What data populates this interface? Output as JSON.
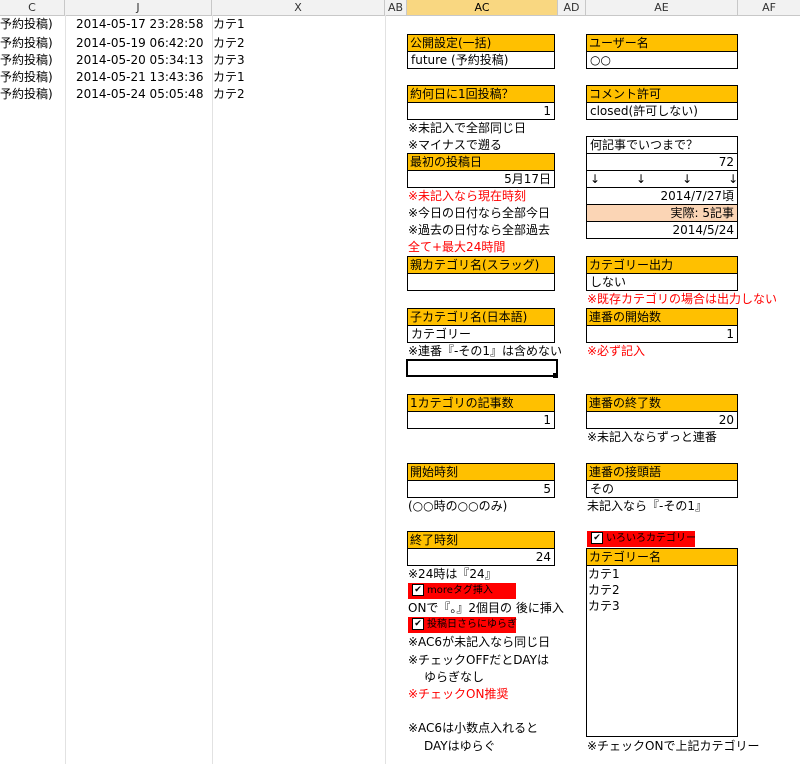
{
  "columns": {
    "c": "C",
    "j": "J",
    "x": "X",
    "ab": "AB",
    "ac": "AC",
    "ad": "AD",
    "ae": "AE",
    "af": "AF"
  },
  "schedule_rows": [
    {
      "type": "予約投稿)",
      "datetime": "2014-05-17 23:28:58",
      "category": "カテ1"
    },
    {
      "type": "予約投稿)",
      "datetime": "2014-05-19 06:42:20",
      "category": "カテ2"
    },
    {
      "type": "予約投稿)",
      "datetime": "2014-05-20 05:34:13",
      "category": "カテ3"
    },
    {
      "type": "予約投稿)",
      "datetime": "2014-05-21 13:43:36",
      "category": "カテ1"
    },
    {
      "type": "予約投稿)",
      "datetime": "2014-05-24 05:05:48",
      "category": "カテ2"
    }
  ],
  "left": {
    "public_label": "公開設定(一括)",
    "public_value": "future (予約投稿)",
    "interval_label": "約何日に1回投稿？",
    "interval_value": "1",
    "note_blank_same": "※未記入で全部同じ日",
    "note_minus": "※マイナスで遡る",
    "first_label": "最初の投稿日",
    "first_value": "5月17日",
    "note_now": "※未記入なら現在時刻",
    "note_today": "※今日の日付なら全部今日",
    "note_past": "※過去の日付なら全部過去",
    "note_max": "全て+最大24時間",
    "parent_label": "親カテゴリ名(スラッグ)",
    "parent_value": "",
    "child_label": "子カテゴリ名(日本語)",
    "child_value": "カテゴリー",
    "note_serial": "※連番『-その1』は含めない",
    "articles_label": "1カテゴリの記事数",
    "articles_value": "1",
    "start_label": "開始時刻",
    "start_value": "5",
    "start_note": "(○○時の○○のみ)",
    "end_label": "終了時刻",
    "end_value": "24",
    "note_24": "※24時は『24』",
    "more_check": "moreタグ挿入",
    "note_on": "ONで『。』2個目の 後に挿入",
    "fuzz_check": "投稿日さらにゆらぎ",
    "note_ac6": "※AC6が未記入なら同じ日",
    "note_off1": "※チェックOFFだとDAYは",
    "note_off2": "ゆらぎなし",
    "note_recommend": "※チェックON推奨",
    "note_decimal1": "※AC6は小数点入れると",
    "note_decimal2": "DAYはゆらぐ"
  },
  "right": {
    "user_label": "ユーザー名",
    "user_value": "○○",
    "comment_label": "コメント許可",
    "comment_value": "closed(許可しない)",
    "until_label": "何記事でいつまで？",
    "until_value": "72",
    "arrows": "↓　　　↓　　　↓　　　↓",
    "until_date": "2014/7/27頃",
    "actual": "実際: 5記事",
    "actual_date": "2014/5/24",
    "cat_out_label": "カテゴリー出力",
    "cat_out_value": "しない",
    "cat_out_note": "※既存カテゴリの場合は出力しない",
    "serial_start_label": "連番の開始数",
    "serial_start_value": "1",
    "serial_required": "※必ず記入",
    "serial_end_label": "連番の終了数",
    "serial_end_value": "20",
    "serial_end_note": "※未記入ならずっと連番",
    "prefix_label": "連番の接頭語",
    "prefix_value": "その",
    "prefix_note": "未記入なら『-その1』",
    "multi_check": "いろいろカテゴリー",
    "catname_label": "カテゴリー名",
    "catnames": [
      "カテ1",
      "カテ2",
      "カテ3"
    ],
    "bottom_note": "※チェックONで上記カテゴリー"
  }
}
